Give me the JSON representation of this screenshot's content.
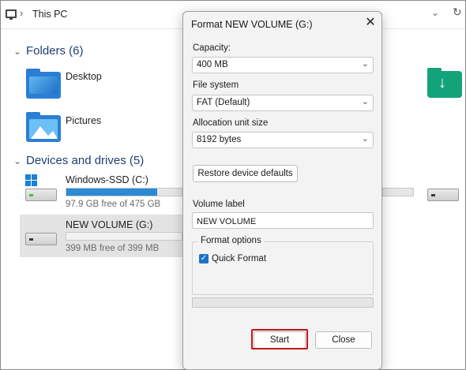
{
  "explorer": {
    "breadcrumb_sep": "›",
    "location": "This PC",
    "folders_header": "Folders (6)",
    "folders": [
      {
        "label": "Desktop",
        "icon": "desktop-folder-icon"
      },
      {
        "label": "Pictures",
        "icon": "pictures-folder-icon"
      },
      {
        "label": "",
        "icon": "downloads-folder-icon"
      }
    ],
    "devices_header": "Devices and drives (5)",
    "drives": [
      {
        "name": "Windows-SSD (C:)",
        "free": "97.9 GB free of 475 GB",
        "used_fraction": 0.79
      },
      {
        "name": "NEW VOLUME (G:)",
        "free": "399 MB free of 399 MB",
        "used_fraction": 0.0
      }
    ]
  },
  "dialog": {
    "title": "Format NEW VOLUME (G:)",
    "close_glyph": "✕",
    "capacity_label": "Capacity:",
    "capacity_value": "400 MB",
    "filesystem_label": "File system",
    "filesystem_value": "FAT (Default)",
    "allocation_label": "Allocation unit size",
    "allocation_value": "8192 bytes",
    "restore_label": "Restore device defaults",
    "volume_label": "Volume label",
    "volume_value": "NEW VOLUME",
    "format_options_label": "Format options",
    "quick_format_label": "Quick Format",
    "quick_format_checked": true,
    "progress": 0,
    "start_label": "Start",
    "close_label": "Close"
  },
  "colors": {
    "accent": "#1a73c9",
    "highlight": "#c4161c",
    "drive_fill": "#2a8ad4"
  }
}
